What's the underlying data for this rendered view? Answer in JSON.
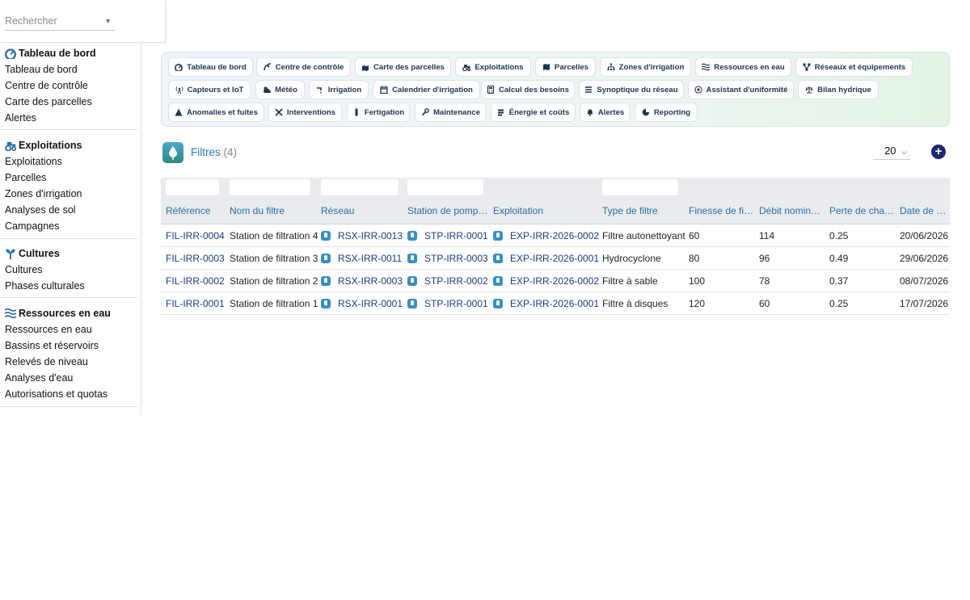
{
  "search": {
    "placeholder": "Rechercher"
  },
  "sidebar": {
    "groups": [
      {
        "title": "Tableau de bord",
        "icon": "gauge-icon",
        "items": [
          "Tableau de bord",
          "Centre de contrôle",
          "Carte des parcelles",
          "Alertes"
        ]
      },
      {
        "title": "Exploitations",
        "icon": "tractor-icon",
        "items": [
          "Exploitations",
          "Parcelles",
          "Zones d'irrigation",
          "Analyses de sol",
          "Campagnes"
        ]
      },
      {
        "title": "Cultures",
        "icon": "seedling-icon",
        "items": [
          "Cultures",
          "Phases culturales"
        ]
      },
      {
        "title": "Ressources en eau",
        "icon": "water-icon",
        "items": [
          "Ressources en eau",
          "Bassins et réservoirs",
          "Relevés de niveau",
          "Analyses d'eau",
          "Autorisations et quotas"
        ]
      }
    ]
  },
  "topnav": {
    "rows": [
      [
        {
          "label": "Tableau de bord",
          "icon": "gauge-icon"
        },
        {
          "label": "Centre de contrôle",
          "icon": "satellite-dish-icon"
        },
        {
          "label": "Carte des parcelles",
          "icon": "map-location-icon"
        },
        {
          "label": "Exploitations",
          "icon": "tractor-icon"
        },
        {
          "label": "Parcelles",
          "icon": "map-icon"
        },
        {
          "label": "Zones d'irrigation",
          "icon": "sitemap-icon"
        },
        {
          "label": "Ressources en eau",
          "icon": "water-icon"
        },
        {
          "label": "Réseaux et équipements",
          "icon": "network-icon"
        }
      ],
      [
        {
          "label": "Capteurs et IoT",
          "icon": "tower-broadcast-icon"
        },
        {
          "label": "Météo",
          "icon": "cloud-sun-icon"
        },
        {
          "label": "Irrigation",
          "icon": "faucet-icon"
        },
        {
          "label": "Calendrier d'irrigation",
          "icon": "calendar-icon"
        },
        {
          "label": "Calcul des besoins",
          "icon": "calculator-icon"
        },
        {
          "label": "Synoptique du réseau",
          "icon": "bars-icon"
        },
        {
          "label": "Assistant d'uniformité",
          "icon": "bullseye-icon"
        },
        {
          "label": "Bilan hydrique",
          "icon": "scale-icon"
        }
      ],
      [
        {
          "label": "Anomalies et fuites",
          "icon": "warning-icon"
        },
        {
          "label": "Interventions",
          "icon": "tools-icon"
        },
        {
          "label": "Fertigation",
          "icon": "flask-icon"
        },
        {
          "label": "Maintenance",
          "icon": "wrench-icon"
        },
        {
          "label": "Énergie et coûts",
          "icon": "bolt-icon"
        },
        {
          "label": "Alertes",
          "icon": "bell-icon"
        },
        {
          "label": "Reporting",
          "icon": "chart-pie-icon"
        }
      ]
    ]
  },
  "header": {
    "title": "Filtres",
    "count": "(4)",
    "page_size": "20"
  },
  "table": {
    "columns": [
      "Référence",
      "Nom du filtre",
      "Réseau",
      "Station de pomp…",
      "Exploitation",
      "Type de filtre",
      "Finesse de fi…",
      "Débit nomin…",
      "Perte de cha…",
      "Date de dern…"
    ],
    "rows": [
      [
        "FIL-IRR-0004",
        "Station de filtration 4",
        "RSX-IRR-0013",
        "STP-IRR-0001",
        "EXP-IRR-2026-0002",
        "Filtre autonettoyant",
        "60",
        "114",
        "0.25",
        "20/06/2026"
      ],
      [
        "FIL-IRR-0003",
        "Station de filtration 3",
        "RSX-IRR-0011",
        "STP-IRR-0003",
        "EXP-IRR-2026-0001",
        "Hydrocyclone",
        "80",
        "96",
        "0.49",
        "29/06/2026"
      ],
      [
        "FIL-IRR-0002",
        "Station de filtration 2",
        "RSX-IRR-0003",
        "STP-IRR-0002",
        "EXP-IRR-2026-0002",
        "Filtre à sable",
        "100",
        "78",
        "0.37",
        "08/07/2026"
      ],
      [
        "FIL-IRR-0001",
        "Station de filtration 1",
        "RSX-IRR-0001",
        "STP-IRR-0001",
        "EXP-IRR-2026-0001",
        "Filtre à disques",
        "120",
        "60",
        "0.25",
        "17/07/2026"
      ]
    ]
  },
  "colors": {
    "accent": "#2a7ab0",
    "link": "#1f3a78",
    "add_button": "#1b2a6b"
  }
}
